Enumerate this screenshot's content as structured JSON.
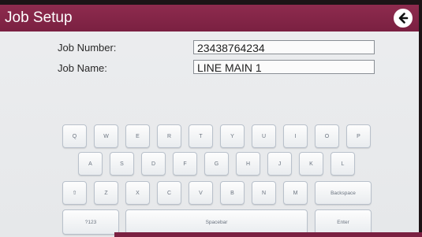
{
  "header": {
    "title": "Job Setup",
    "back_icon": "arrow-left-icon"
  },
  "form": {
    "job_number": {
      "label": "Job Number:",
      "value": "23438764234"
    },
    "job_name": {
      "label": "Job Name:",
      "value": "LINE MAIN 1"
    }
  },
  "keyboard": {
    "row1": [
      "Q",
      "W",
      "E",
      "R",
      "T",
      "Y",
      "U",
      "I",
      "O",
      "P"
    ],
    "row2": [
      "A",
      "S",
      "D",
      "F",
      "G",
      "H",
      "J",
      "K",
      "L"
    ],
    "row3": [
      "⇧",
      "Z",
      "X",
      "C",
      "V",
      "B",
      "N",
      "M"
    ],
    "backspace": "Backspace",
    "mode": "?123",
    "spacebar": "Spacebar",
    "enter": "Enter"
  },
  "colors": {
    "header": "#7a2041",
    "background": "#e9ebed",
    "key_border": "#b9c1cb"
  }
}
